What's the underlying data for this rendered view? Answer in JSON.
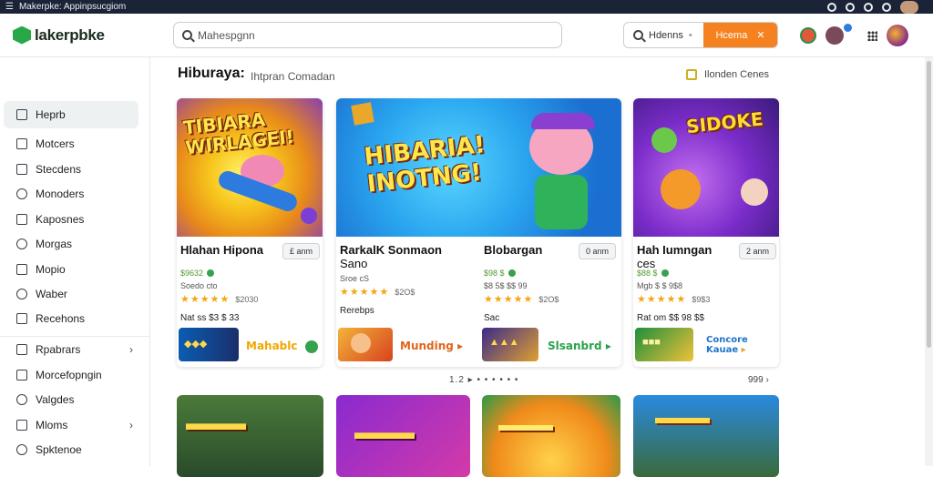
{
  "window": {
    "title": "Makerpke: Appinpsucgiom"
  },
  "header": {
    "brand": "lakerpbke",
    "search_placeholder": "Mahespgnn",
    "filter_label": "Hdenns",
    "filter_button": "Hcema"
  },
  "sidebar": {
    "items": [
      {
        "label": "Heprb",
        "icon": "square-icon"
      },
      {
        "label": "Motcers",
        "icon": "note-icon"
      },
      {
        "label": "Stecdens",
        "icon": "list-icon"
      },
      {
        "label": "Monoders",
        "icon": "heart-icon"
      },
      {
        "label": "Kaposnes",
        "icon": "edit-icon"
      },
      {
        "label": "Morgas",
        "icon": "target-icon"
      },
      {
        "label": "Mopio",
        "icon": "doc-icon"
      },
      {
        "label": "Waber",
        "icon": "shield-icon"
      },
      {
        "label": "Recehons",
        "icon": "calendar-icon"
      },
      {
        "label": "Rpabrars",
        "icon": "image-icon"
      },
      {
        "label": "Morcefopngin",
        "icon": "folder-icon"
      },
      {
        "label": "Valgdes",
        "icon": "check-icon"
      },
      {
        "label": "Mloms",
        "icon": "grid-icon"
      },
      {
        "label": "Spktenoe",
        "icon": "pin-icon"
      }
    ]
  },
  "main": {
    "title": "Hiburaya:",
    "subtitle": "Ihtpran Comadan",
    "right_label": "Ilonden Cenes",
    "cards": [
      {
        "art_text": "TIBIARA WIRLAGEI!",
        "title": "Hlahan Hipona",
        "title2": "",
        "price": "£ anm",
        "meta": "$9632",
        "meta2": "Soedo cto",
        "rating": "★★★★★",
        "rating_count": "$2030",
        "row": "Nat ss $3 $ 33",
        "mini_label": "Mahablc",
        "mini_label_color": "#f0a800"
      },
      {
        "art_text": "HIBARIA! INOTNG!",
        "title": "RarkalK Sonmaon",
        "title2": "Sano",
        "price": "",
        "meta": "",
        "meta2": "Sroe cS",
        "rating": "★★★★★",
        "rating_count": "$2O$",
        "row": "Rerebps",
        "mini_label": "Munding",
        "mini_label_color": "#e0641c"
      },
      {
        "art_text": "",
        "title": "Blobargan",
        "title2": "",
        "price": "0 anm",
        "meta": "$98 $",
        "meta2": "$8 5$ $$ 99",
        "rating": "★★★★★",
        "rating_count": "$2O$",
        "row": "Sac",
        "mini_label": "Slsanbrd",
        "mini_label_color": "#2aa24a"
      },
      {
        "art_text": "SIDOKE",
        "title": "Hah Iumngan",
        "title2": "ces",
        "price": "2 anm",
        "meta": "$88 $",
        "meta2": "Mgb $ $ 9$8",
        "rating": "★★★★★",
        "rating_count": "$9$3",
        "row": "Rat om $$ 98 $$",
        "mini_label": "Concore Kauae",
        "mini_label_color": "#1e74c8"
      }
    ],
    "pager": "1.2 ▸ • • • • • •",
    "pager_right": "999 ›"
  },
  "colors": {
    "accent": "#f5821f",
    "brand": "#29a84a",
    "star": "#f3a614"
  }
}
